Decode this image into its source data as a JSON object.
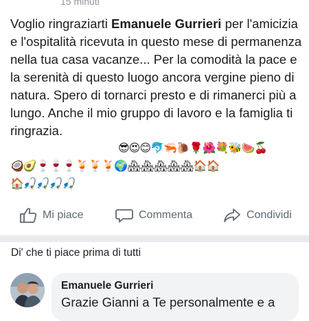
{
  "post": {
    "timestamp": "15 minuti",
    "text_before_name": "Voglio ringraziarti ",
    "mentioned_name": "Emanuele Gurrieri",
    "text_after_name": " per l'amicizia e l'ospitalità ricevuta in questo mese di permanenza nella tua casa vacanze... Per la comodità la pace e la serenità di questo luogo ancora vergine pieno di natura. Spero di tornarci presto e di rimanerci più a lungo. Anche il mio gruppo di lavoro e la famiglia ti ringrazia.",
    "emoji_line_1": "😎😍😊🐬🦐🐌🌹🌺💐🐝🍉🍒",
    "emoji_line_2": "🥥🥑🍷🍷🍷🍹🍹🍹🌍🏘🏘🏘🏘🏘🏠🏠",
    "emoji_line_3": "🏠🎣🎣🎣🎣"
  },
  "actions": {
    "like_label": "Mi piace",
    "comment_label": "Commenta",
    "share_label": "Condividi"
  },
  "first_like_prompt": "Di' che ti piace prima di tutti",
  "comment": {
    "author": "Emanuele Gurrieri",
    "text": "Grazie Gianni a Te personalmente e a"
  },
  "colors": {
    "text": "#1c1e21",
    "secondary": "#606770",
    "divider": "#e9ebee",
    "bubble": "#f2f3f5"
  }
}
